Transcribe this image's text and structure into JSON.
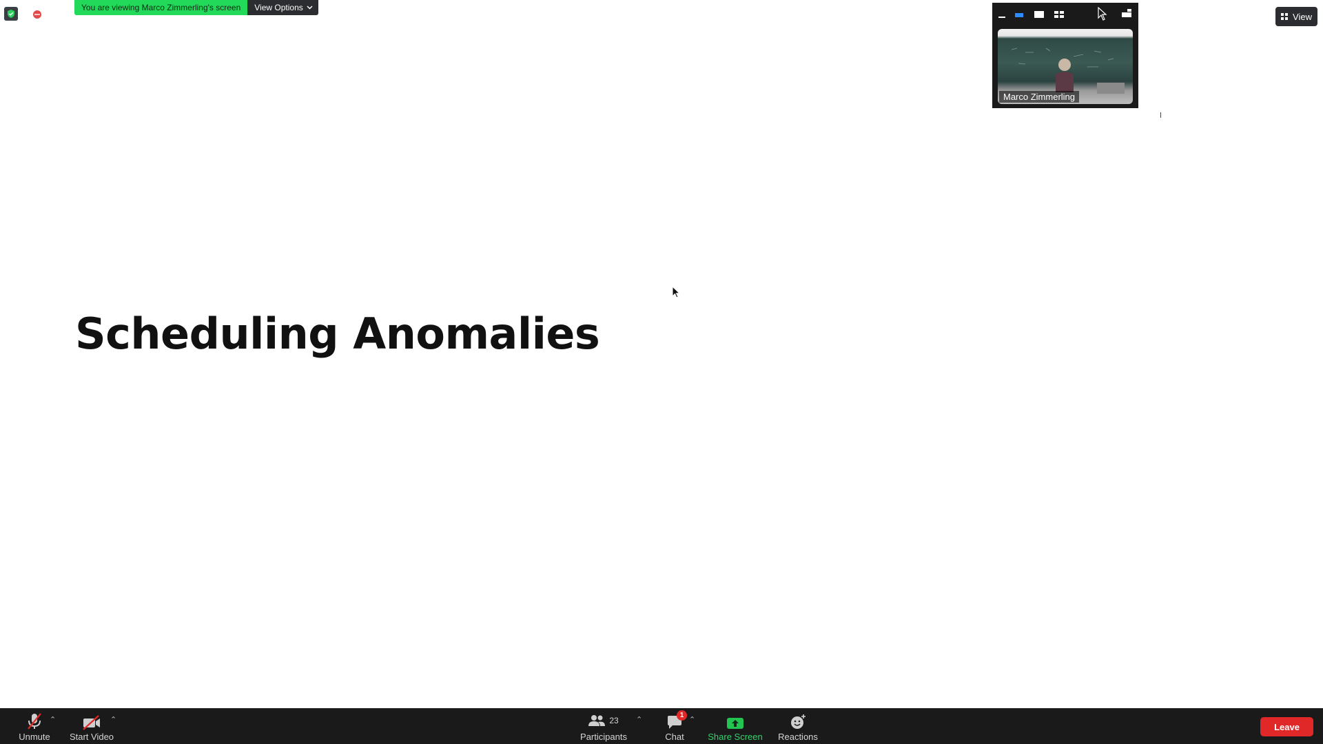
{
  "banner": {
    "viewing_text": "You are viewing Marco Zimmerling's screen",
    "view_options_label": "View Options"
  },
  "thumbnail": {
    "participant_name": "Marco Zimmerling"
  },
  "top_right": {
    "view_label": "View"
  },
  "slide": {
    "title": "Scheduling Anomalies"
  },
  "toolbar": {
    "unmute_label": "Unmute",
    "start_video_label": "Start Video",
    "participants_label": "Participants",
    "participants_count": "23",
    "chat_label": "Chat",
    "chat_badge": "1",
    "share_screen_label": "Share Screen",
    "reactions_label": "Reactions",
    "leave_label": "Leave"
  },
  "colors": {
    "banner_green": "#23d959",
    "toolbar_bg": "#1a1a1a",
    "leave_red": "#e02828",
    "share_green": "#34d36b"
  }
}
